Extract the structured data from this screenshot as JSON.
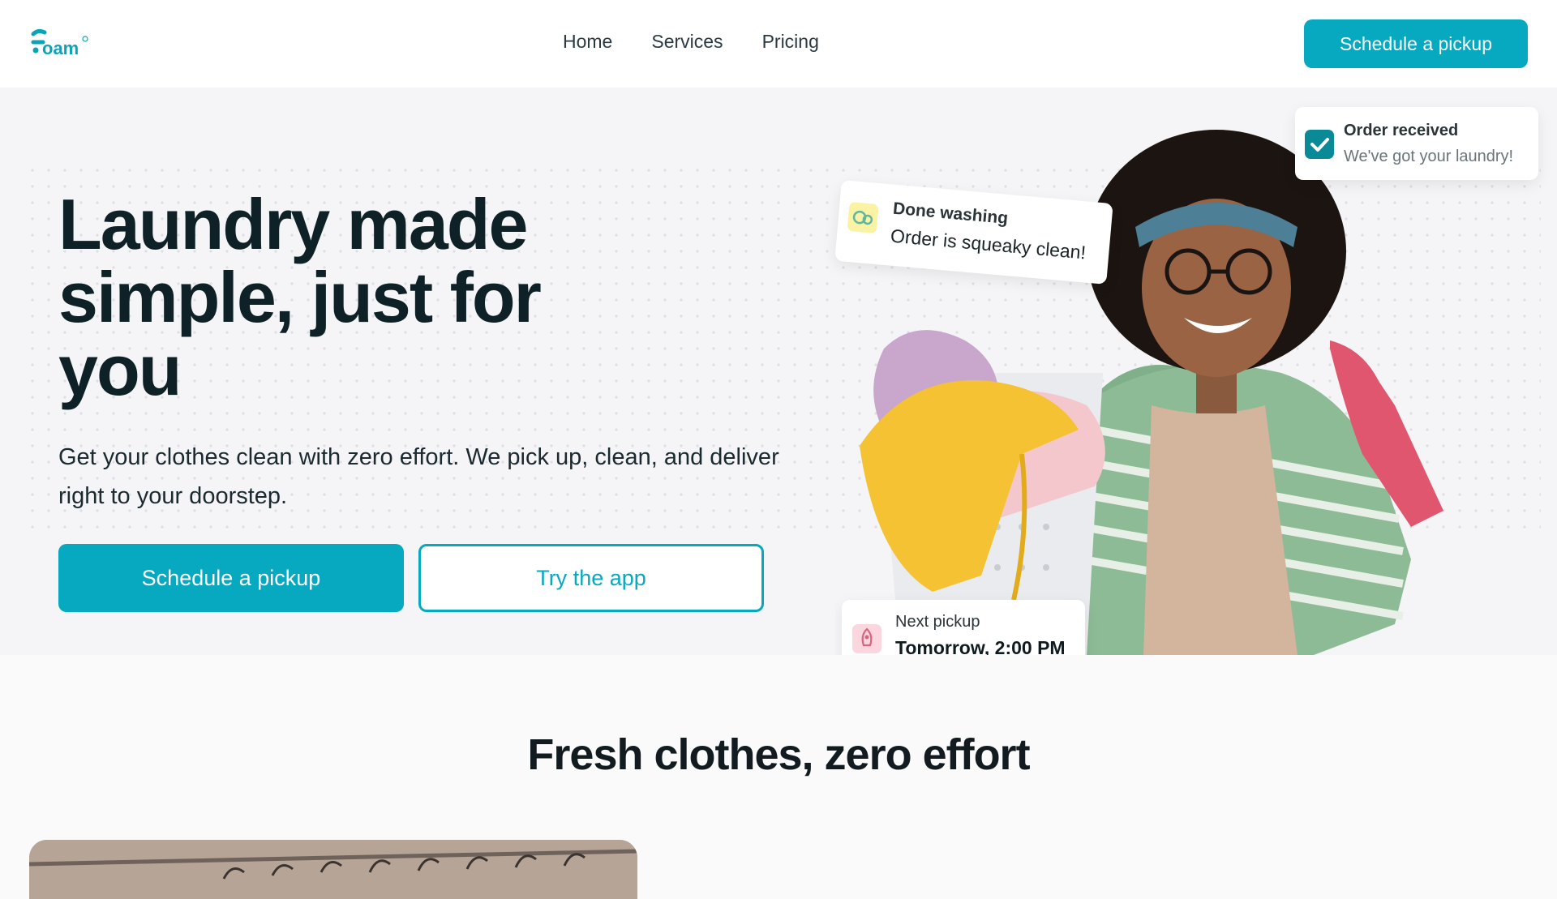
{
  "header": {
    "logo_text": "foam",
    "nav": [
      {
        "label": "Home"
      },
      {
        "label": "Services"
      },
      {
        "label": "Pricing"
      }
    ],
    "cta_label": "Schedule a pickup"
  },
  "hero": {
    "title": "Laundry made simple, just for you",
    "subtitle": "Get your clothes clean with zero effort. We pick up, clean, and deliver right to your doorstep.",
    "primary_cta": "Schedule a pickup",
    "secondary_cta": "Try the app"
  },
  "cards": {
    "order": {
      "title": "Order received",
      "subtitle": "We've got your laundry!",
      "icon": "check-icon"
    },
    "wash": {
      "title": "Done washing",
      "subtitle": "Order is squeaky clean!",
      "icon": "bubbles-icon"
    },
    "pickup": {
      "title": "Next pickup",
      "subtitle": "Tomorrow, 2:00 PM",
      "icon": "rocket-icon"
    }
  },
  "section": {
    "title": "Fresh clothes, zero effort"
  },
  "colors": {
    "accent": "#06a9bf",
    "heading": "#0d2126",
    "background": "#f5f5f7"
  }
}
